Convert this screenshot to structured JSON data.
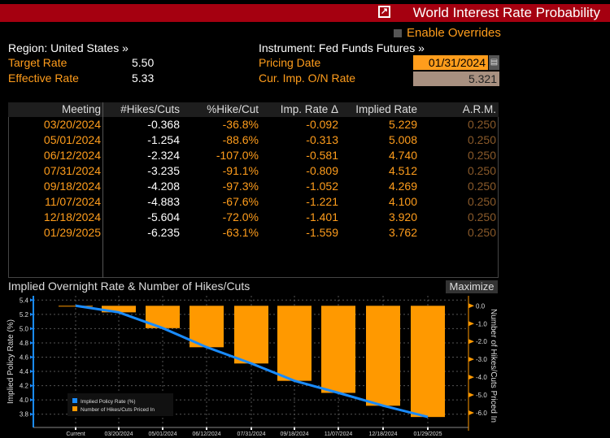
{
  "header": {
    "title": "World Interest Rate Probability",
    "icon": "external-link-icon"
  },
  "overrides": {
    "label": "Enable Overrides",
    "checked": false
  },
  "region": {
    "label": "Region: United States »"
  },
  "instrument": {
    "label": "Instrument: Fed Funds Futures »"
  },
  "target_rate": {
    "label": "Target Rate",
    "value": "5.50"
  },
  "effective_rate": {
    "label": "Effective Rate",
    "value": "5.33"
  },
  "pricing_date": {
    "label": "Pricing Date",
    "value": "01/31/2024",
    "icon": "calendar-icon"
  },
  "cur_imp_rate": {
    "label": "Cur. Imp. O/N Rate",
    "value": "5.321"
  },
  "table": {
    "columns": [
      "Meeting",
      "#Hikes/Cuts",
      "%Hike/Cut",
      "Imp. Rate Δ",
      "Implied Rate",
      "A.R.M."
    ],
    "rows": [
      [
        "03/20/2024",
        "-0.368",
        "-36.8%",
        "-0.092",
        "5.229",
        "0.250"
      ],
      [
        "05/01/2024",
        "-1.254",
        "-88.6%",
        "-0.313",
        "5.008",
        "0.250"
      ],
      [
        "06/12/2024",
        "-2.324",
        "-107.0%",
        "-0.581",
        "4.740",
        "0.250"
      ],
      [
        "07/31/2024",
        "-3.235",
        "-91.1%",
        "-0.809",
        "4.512",
        "0.250"
      ],
      [
        "09/18/2024",
        "-4.208",
        "-97.3%",
        "-1.052",
        "4.269",
        "0.250"
      ],
      [
        "11/07/2024",
        "-4.883",
        "-67.6%",
        "-1.221",
        "4.100",
        "0.250"
      ],
      [
        "12/18/2024",
        "-5.604",
        "-72.0%",
        "-1.401",
        "3.920",
        "0.250"
      ],
      [
        "01/29/2025",
        "-6.235",
        "-63.1%",
        "-1.559",
        "3.762",
        "0.250"
      ]
    ]
  },
  "chart_title": "Implied Overnight Rate & Number of Hikes/Cuts",
  "maximize_label": "Maximize",
  "chart_data": {
    "type": "bar+line",
    "categories": [
      "Current",
      "03/20/2024",
      "05/01/2024",
      "06/12/2024",
      "07/31/2024",
      "09/18/2024",
      "11/07/2024",
      "12/18/2024",
      "01/29/2025"
    ],
    "series": [
      {
        "name": "Implied Policy Rate (%)",
        "type": "line",
        "axis": "left",
        "color": "#1a8cff",
        "values": [
          5.321,
          5.229,
          5.008,
          4.74,
          4.512,
          4.269,
          4.1,
          3.92,
          3.762
        ]
      },
      {
        "name": "Number of Hikes/Cuts Priced In",
        "type": "bar",
        "axis": "right",
        "color": "#ff9900",
        "values": [
          0,
          -0.368,
          -1.254,
          -2.324,
          -3.235,
          -4.208,
          -4.883,
          -5.604,
          -6.235
        ]
      }
    ],
    "ylabel": "Implied Policy Rate (%)",
    "ylim": [
      3.8,
      5.4
    ],
    "yticks": [
      "5.4",
      "5.2",
      "5.0",
      "4.8",
      "4.6",
      "4.4",
      "4.2",
      "4.0",
      "3.8"
    ],
    "y2label": "Number of Hikes/Cuts Priced In",
    "y2lim": [
      -6.0,
      0.0
    ],
    "y2ticks": [
      "0.0",
      "-1.0",
      "-2.0",
      "-3.0",
      "-4.0",
      "-5.0",
      "-6.0"
    ],
    "grid": true,
    "legend": "bottom-left"
  }
}
